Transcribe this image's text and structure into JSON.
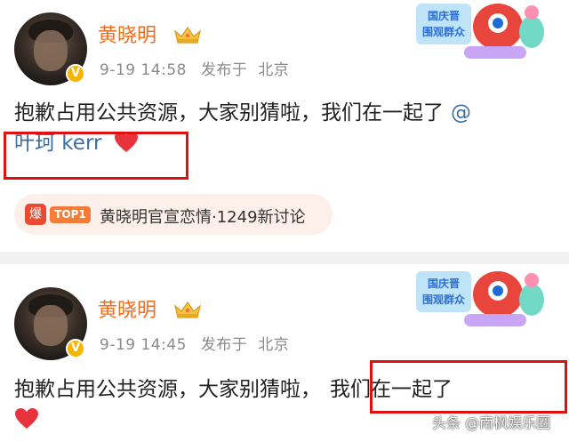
{
  "posts": [
    {
      "username": "黄晓明",
      "time": "9-19 14:58",
      "published_label": "发布于",
      "location": "北京",
      "content_text": "抱歉占用公共资源，大家别猜啦，我们在一起了",
      "mention_at": "@",
      "mention_name": "叶珂 kerr",
      "topic_badge": "爆",
      "topic_rank": "TOP1",
      "topic_text": "黄晓明官宣恋情·1249新讨论"
    },
    {
      "username": "黄晓明",
      "time": "9-19 14:45",
      "published_label": "发布于",
      "location": "北京",
      "content_prefix": "抱歉占用公共资源，大家别猜啦，",
      "content_highlight": "我们在一起了"
    }
  ],
  "promo_banner": {
    "line1": "国庆晋",
    "line2": "围观群众"
  },
  "colors": {
    "username": "#f26d1e",
    "mention": "#3a6ea5",
    "highlight_box": "#e01010",
    "heart": "#e8333c"
  },
  "icons": [
    "avatar",
    "verified-v-badge",
    "crown-icon",
    "heart-icon",
    "hot-badge"
  ],
  "watermark": "头条 @南枫娱乐圈"
}
